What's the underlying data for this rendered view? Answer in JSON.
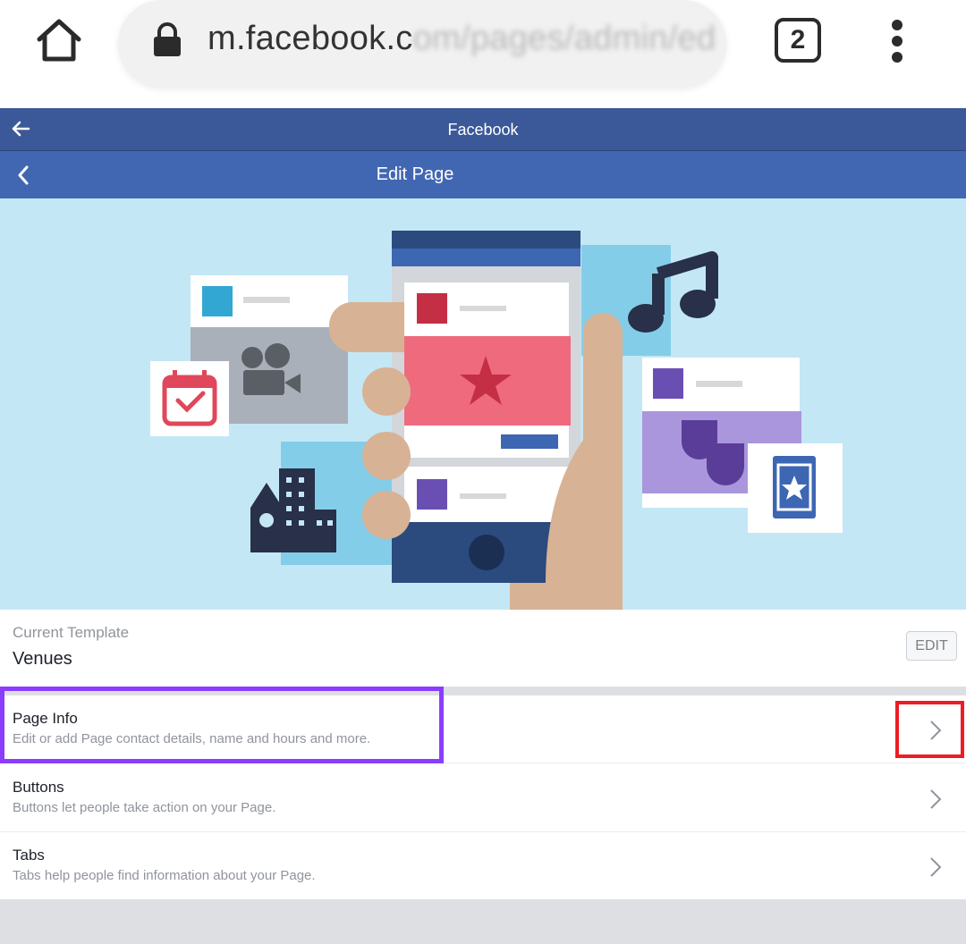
{
  "browser": {
    "url_visible": "m.facebook.c",
    "url_blurred": "om/pages/admin/ed",
    "tab_count": "2"
  },
  "header": {
    "title": "Facebook"
  },
  "edit_page": {
    "title": "Edit Page"
  },
  "template": {
    "label": "Current Template",
    "value": "Venues",
    "edit_label": "EDIT"
  },
  "rows": [
    {
      "title": "Page Info",
      "subtitle": "Edit or add Page contact details, name and hours and more."
    },
    {
      "title": "Buttons",
      "subtitle": "Buttons let people take action on your Page."
    },
    {
      "title": "Tabs",
      "subtitle": "Tabs help people find information about your Page."
    }
  ],
  "colors": {
    "fb_blue": "#3b5998",
    "fb_blue_light": "#4267b2",
    "highlight_purple": "#8b3dff",
    "highlight_red": "#ee1c24"
  }
}
